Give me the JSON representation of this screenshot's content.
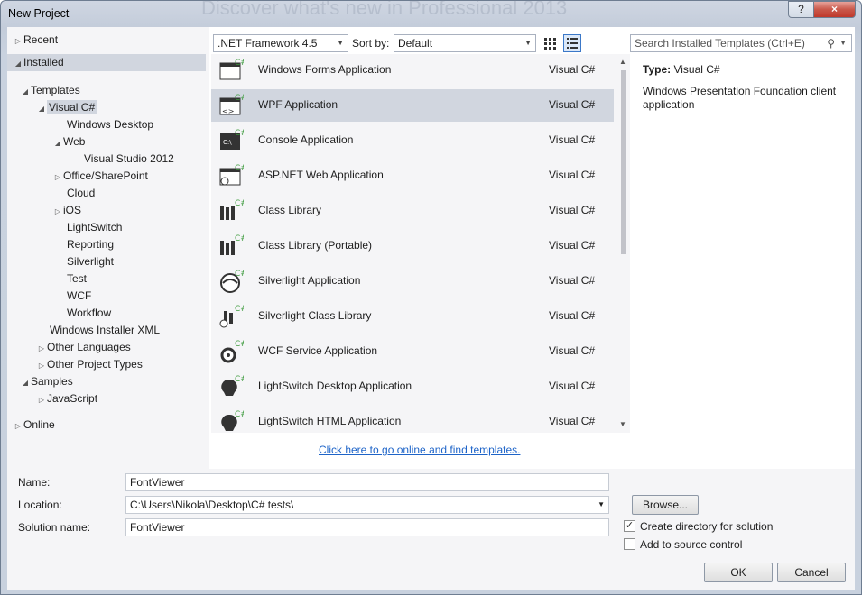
{
  "window": {
    "title": "New Project",
    "background_title": "Discover what's new in Professional 2013",
    "help_label": "?",
    "close_label": "×"
  },
  "tree": {
    "recent": "Recent",
    "installed": "Installed",
    "templates": "Templates",
    "visual_csharp": "Visual C#",
    "windows_desktop": "Windows Desktop",
    "web": "Web",
    "visual_studio_2012": "Visual Studio 2012",
    "office_sharepoint": "Office/SharePoint",
    "cloud": "Cloud",
    "ios": "iOS",
    "lightswitch": "LightSwitch",
    "reporting": "Reporting",
    "silverlight": "Silverlight",
    "test": "Test",
    "wcf": "WCF",
    "workflow": "Workflow",
    "windows_installer_xml": "Windows Installer XML",
    "other_languages": "Other Languages",
    "other_project_types": "Other Project Types",
    "samples": "Samples",
    "javascript": "JavaScript",
    "online": "Online"
  },
  "toolbar": {
    "framework": ".NET Framework 4.5",
    "sort_label": "Sort by:",
    "sort_value": "Default"
  },
  "search": {
    "placeholder": "Search Installed Templates (Ctrl+E)"
  },
  "templates": [
    {
      "name": "Windows Forms Application",
      "lang": "Visual C#",
      "icon": "windows-forms-icon"
    },
    {
      "name": "WPF Application",
      "lang": "Visual C#",
      "icon": "wpf-icon"
    },
    {
      "name": "Console Application",
      "lang": "Visual C#",
      "icon": "console-icon"
    },
    {
      "name": "ASP.NET Web Application",
      "lang": "Visual C#",
      "icon": "aspnet-icon"
    },
    {
      "name": "Class Library",
      "lang": "Visual C#",
      "icon": "class-library-icon"
    },
    {
      "name": "Class Library (Portable)",
      "lang": "Visual C#",
      "icon": "class-library-portable-icon"
    },
    {
      "name": "Silverlight Application",
      "lang": "Visual C#",
      "icon": "silverlight-icon"
    },
    {
      "name": "Silverlight Class Library",
      "lang": "Visual C#",
      "icon": "silverlight-class-library-icon"
    },
    {
      "name": "WCF Service Application",
      "lang": "Visual C#",
      "icon": "wcf-icon"
    },
    {
      "name": "LightSwitch Desktop Application",
      "lang": "Visual C#",
      "icon": "lightswitch-desktop-icon"
    },
    {
      "name": "LightSwitch HTML Application",
      "lang": "Visual C#",
      "icon": "lightswitch-html-icon"
    }
  ],
  "online_link": "Click here to go online and find templates.",
  "details": {
    "type_label": "Type:",
    "type_value": "Visual C#",
    "description": "Windows Presentation Foundation client application"
  },
  "form": {
    "name_label": "Name:",
    "name_value": "FontViewer",
    "location_label": "Location:",
    "location_value": "C:\\Users\\Nikola\\Desktop\\C# tests\\",
    "solution_label": "Solution name:",
    "solution_value": "FontViewer",
    "browse_label": "Browse...",
    "create_dir_label": "Create directory for solution",
    "create_dir_checked": true,
    "source_control_label": "Add to source control",
    "source_control_checked": false,
    "ok_label": "OK",
    "cancel_label": "Cancel"
  },
  "colors": {
    "selection": "#d1d6df",
    "link": "#1e64c8",
    "csharp_green": "#3c9a3c"
  }
}
